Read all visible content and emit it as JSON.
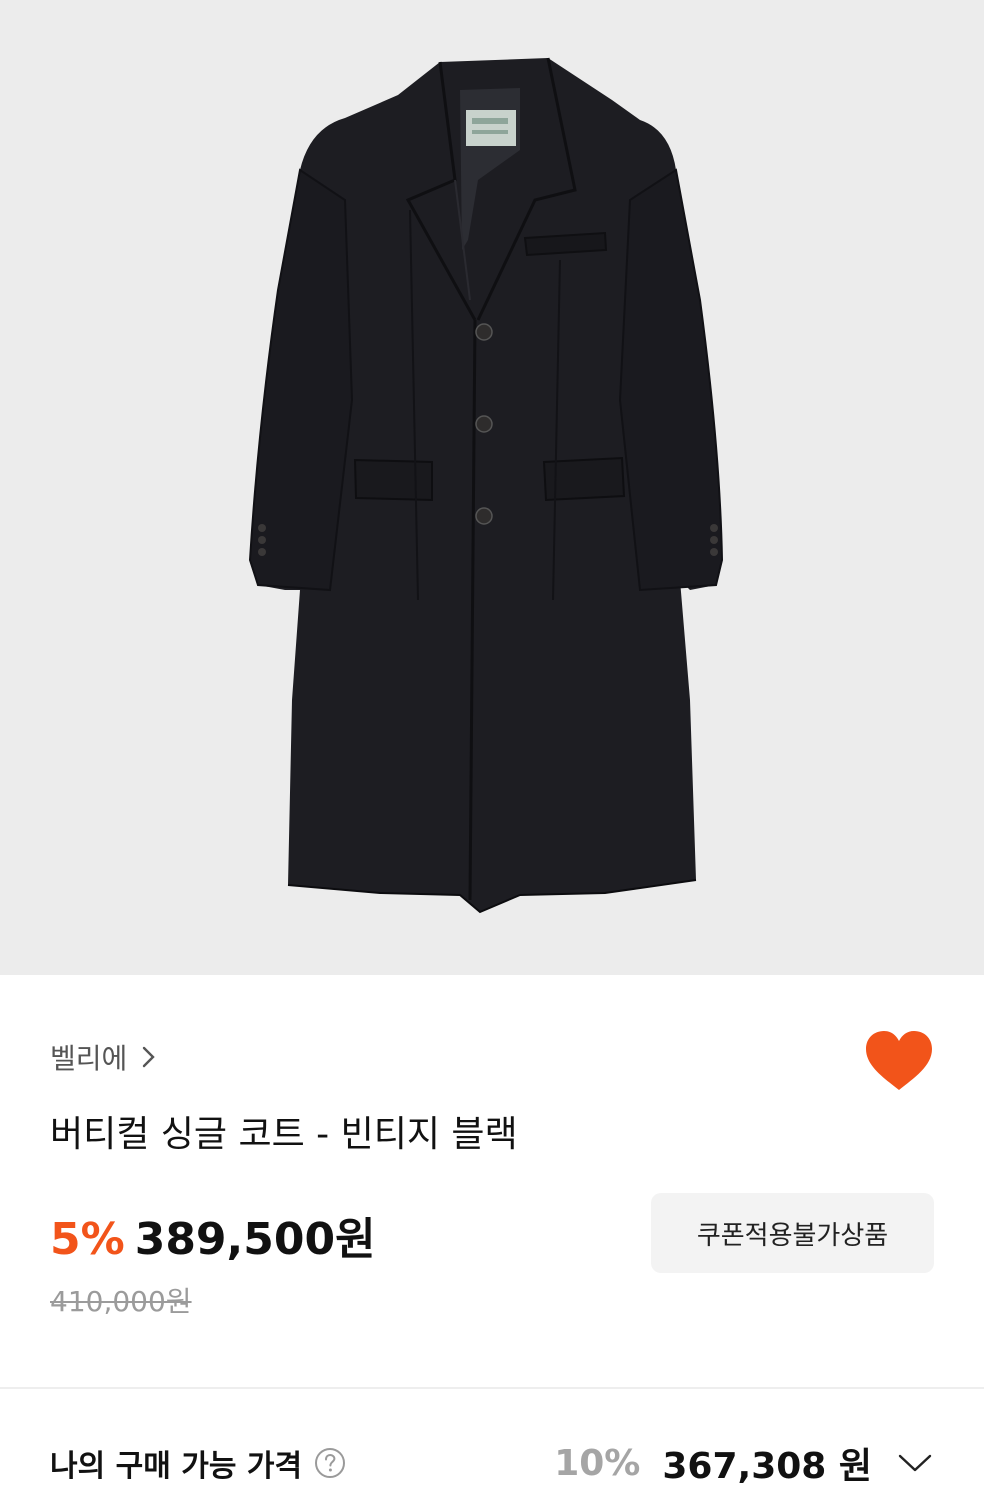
{
  "product": {
    "image_icon": "wool-coat-photo",
    "brand": "벨리에",
    "title": "버티컬 싱글 코트 - 빈티지 블랙",
    "discount": "5%",
    "price": "389,500원",
    "original_price": "410,000원",
    "coupon_badge": "쿠폰적용불가상품",
    "liked": true
  },
  "my_price": {
    "label": "나의 구매 가능 가격",
    "discount": "10%",
    "amount": "367,308 원"
  },
  "colors": {
    "accent": "#f2541a",
    "background_image": "#ececec",
    "coat": "#1d1d22"
  }
}
